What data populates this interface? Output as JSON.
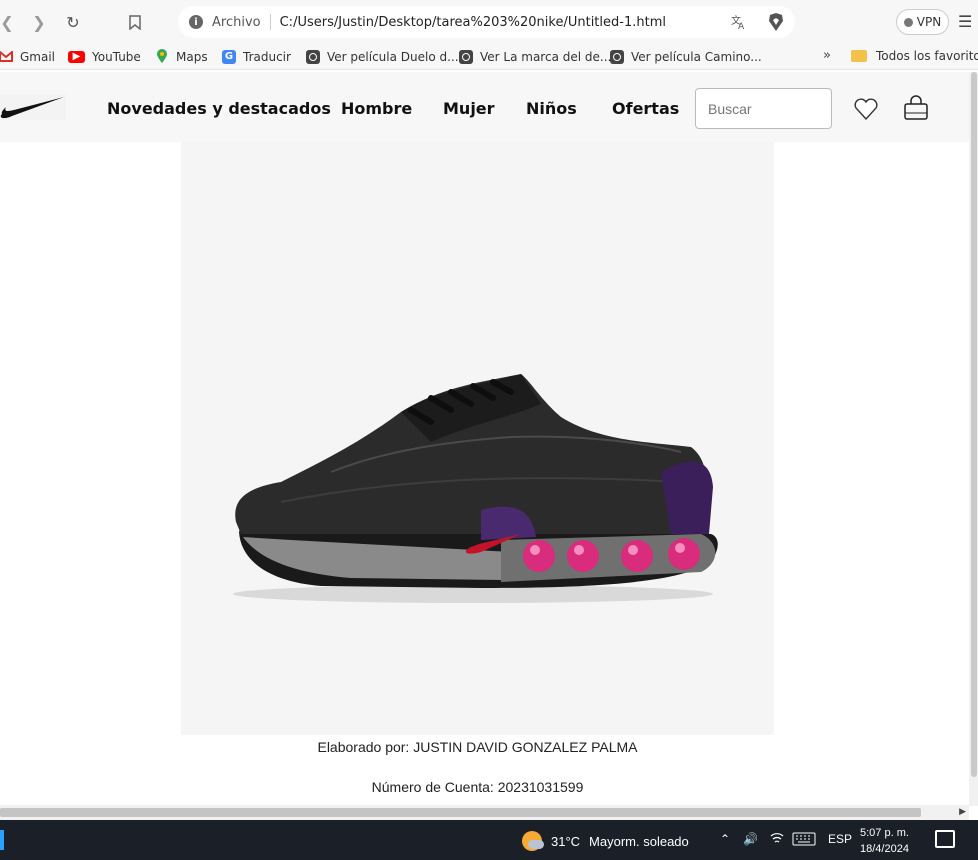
{
  "browser": {
    "address_scheme": "Archivo",
    "address_url": "C:/Users/Justin/Desktop/tarea%203%20nike/Untitled-1.html",
    "vpn_label": "VPN"
  },
  "bookmarks": {
    "items": [
      {
        "label": "Gmail",
        "icon": "gmail-icon",
        "color": "#d93025"
      },
      {
        "label": "YouTube",
        "icon": "youtube-icon",
        "color": "#ff0000"
      },
      {
        "label": "Maps",
        "icon": "maps-icon",
        "color": "#34a853"
      },
      {
        "label": "Traducir",
        "icon": "translate-icon",
        "color": "#4285f4"
      },
      {
        "label": "Ver película Duelo d...",
        "icon": "globe-icon"
      },
      {
        "label": "Ver La marca del de...",
        "icon": "globe-icon"
      },
      {
        "label": "Ver película Camino...",
        "icon": "globe-icon"
      }
    ],
    "more": "»",
    "all_favorites": "Todos los favoritos"
  },
  "site": {
    "nav": [
      "Novedades y destacados",
      "Hombre",
      "Mujer",
      "Niños",
      "Ofertas"
    ],
    "search_placeholder": "Buscar",
    "credit_author": "Elaborado por: JUSTIN DAVID GONZALEZ PALMA",
    "credit_account": "Número de Cuenta: 20231031599"
  },
  "taskbar": {
    "temperature": "31°C",
    "weather": "Mayorm. soleado",
    "language": "ESP",
    "time": "5:07 p. m.",
    "date": "18/4/2024"
  },
  "colors": {
    "accent_vpn_dot": "#777777",
    "brand_black": "#111111",
    "product_bg": "#f5f5f5",
    "taskbar_bg": "#1a1f28"
  }
}
